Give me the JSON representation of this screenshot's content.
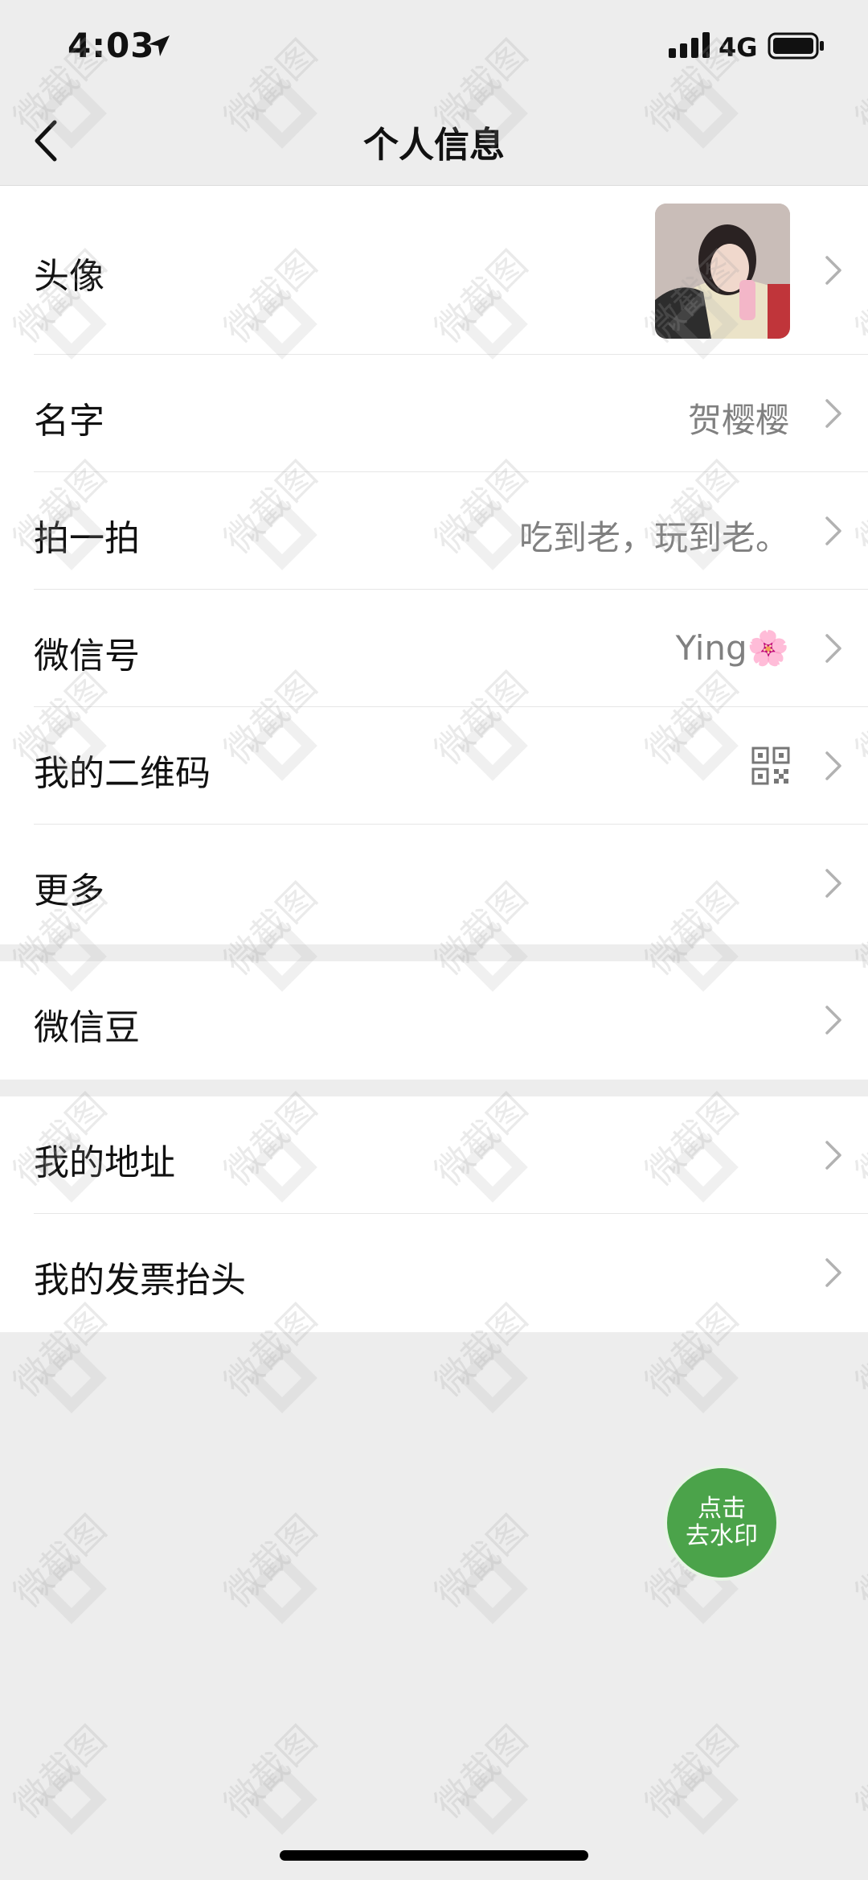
{
  "status_bar": {
    "time": "4:03",
    "network": "4G"
  },
  "nav": {
    "title": "个人信息"
  },
  "profile_rows": [
    {
      "label": "头像",
      "value": ""
    },
    {
      "label": "名字",
      "value": "贺樱樱"
    },
    {
      "label": "拍一拍",
      "value": "吃到老，玩到老。"
    },
    {
      "label": "微信号",
      "value": "Ying🌸"
    },
    {
      "label": "我的二维码",
      "value": ""
    },
    {
      "label": "更多",
      "value": ""
    }
  ],
  "beans_row": {
    "label": "微信豆"
  },
  "address_rows": [
    {
      "label": "我的地址"
    },
    {
      "label": "我的发票抬头"
    }
  ],
  "fab": {
    "line1": "点击",
    "line2": "去水印"
  },
  "watermark": {
    "text": "微截图"
  },
  "colors": {
    "background": "#ededed",
    "card": "#ffffff",
    "secondary_text": "#808080",
    "fab": "#4ba34a"
  }
}
